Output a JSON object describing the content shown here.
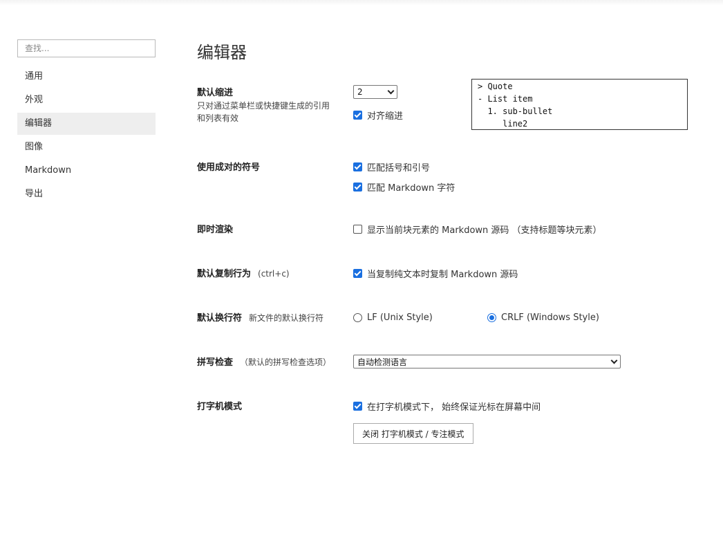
{
  "sidebar": {
    "search_placeholder": "查找...",
    "items": [
      {
        "label": "通用"
      },
      {
        "label": "外观"
      },
      {
        "label": "编辑器"
      },
      {
        "label": "图像"
      },
      {
        "label": "Markdown"
      },
      {
        "label": "导出"
      }
    ],
    "active_index": 2
  },
  "main": {
    "title": "编辑器",
    "indent": {
      "label": "默认缩进",
      "desc": "只对通过菜单栏或快捷键生成的引用和列表有效",
      "value": "2",
      "align_label": "对齐缩进",
      "align_checked": true,
      "preview": "> Quote\n- List item\n  1. sub-bullet\n     line2"
    },
    "pairs": {
      "label": "使用成对的符号",
      "opt1": "匹配括号和引号",
      "opt2": "匹配 Markdown 字符"
    },
    "live": {
      "label": "即时渲染",
      "opt": "显示当前块元素的 Markdown 源码 （支持标题等块元素）"
    },
    "copy": {
      "label": "默认复制行为",
      "sub": "(ctrl+c)",
      "opt": "当复制纯文本时复制 Markdown 源码"
    },
    "newline": {
      "label": "默认换行符",
      "sub": "新文件的默认换行符",
      "lf": "LF (Unix Style)",
      "crlf": "CRLF (Windows Style)",
      "selected": "crlf"
    },
    "spell": {
      "label": "拼写检查",
      "sub": "（默认的拼写检查选项）",
      "value": "自动检测语言"
    },
    "typewriter": {
      "label": "打字机模式",
      "opt": "在打字机模式下， 始终保证光标在屏幕中间",
      "button": "关闭 打字机模式 / 专注模式"
    }
  },
  "colors": {
    "accent": "#1a6fe0",
    "active_nav_bg": "#eeeeee"
  }
}
